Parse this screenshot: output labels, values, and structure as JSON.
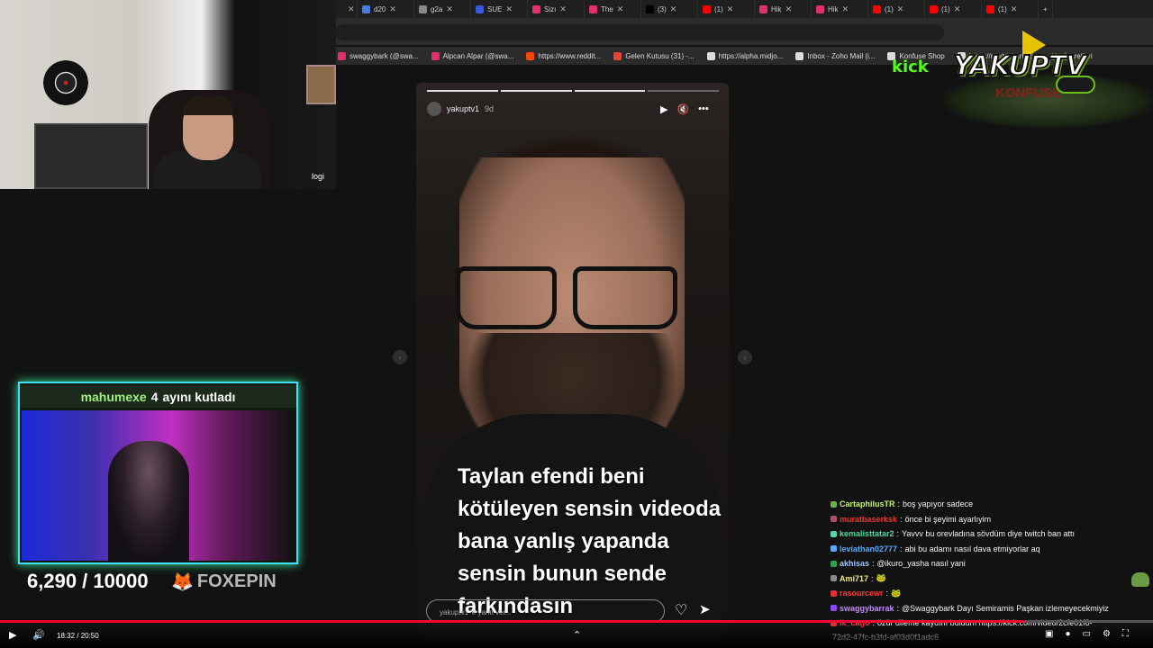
{
  "tabs": [
    {
      "label": "",
      "color": "#444444"
    },
    {
      "label": "d20",
      "color": "#4a7bd8"
    },
    {
      "label": "g2a",
      "color": "#888888"
    },
    {
      "label": "SUE",
      "color": "#3a5bd8"
    },
    {
      "label": "Sizı",
      "color": "#e1306c"
    },
    {
      "label": "The",
      "color": "#e1306c"
    },
    {
      "label": "(3) ",
      "color": "#000000"
    },
    {
      "label": "(1) ",
      "color": "#ff0000"
    },
    {
      "label": "Hik",
      "color": "#e1306c"
    },
    {
      "label": "Hik",
      "color": "#e1306c"
    },
    {
      "label": "(1) ",
      "color": "#ff0000"
    },
    {
      "label": "(1) ",
      "color": "#ff0000"
    },
    {
      "label": "(1) ",
      "color": "#ff0000"
    }
  ],
  "new_tab": "+",
  "bookmarks": [
    {
      "label": "swaggybark (@swa...",
      "color": "#e1306c"
    },
    {
      "label": "Alpcan Alpar (@swa...",
      "color": "#e1306c"
    },
    {
      "label": "https://www.reddit...",
      "color": "#ff4500"
    },
    {
      "label": "Gelen Kutusu (31) -...",
      "color": "#ea4335"
    },
    {
      "label": "https://alpha.midjo...",
      "color": "#dddddd"
    },
    {
      "label": "Inbox - Zoho Mail (i...",
      "color": "#dddddd"
    },
    {
      "label": "Konfuse Shop",
      "color": "#dddddd"
    },
    {
      "label": "https://next.inkarnati...",
      "color": "#dddddd"
    }
  ],
  "bookmarks_trailing": "Yer İşaretleri",
  "webcam": {
    "label": "logi"
  },
  "story": {
    "username": "yakuptv1",
    "age": "9d",
    "caption": "Taylan efendi beni kötüleyen sensin videoda bana yanlış yapanda sensin bunun sende farkındasın",
    "reply_placeholder": "yakuptv1 'e yanıt ver...",
    "icons": [
      "play-icon",
      "mute-icon",
      "more-icon"
    ],
    "progress_segments": 4,
    "progress_filled": 3
  },
  "logo": {
    "kick": "kick",
    "brand": "YAKUPTV",
    "bg_text": "KONFUSE"
  },
  "alert": {
    "name": "mahumexe",
    "months": "4",
    "suffix": "ayını kutladı"
  },
  "goal": {
    "text": "6,290 / 10000",
    "sponsor": "FOXEPIN"
  },
  "chat": [
    {
      "user": "CartaphilusTR",
      "color": "#c7f36a",
      "text": "boş yapıyor sadece",
      "badge": "#6ab04c"
    },
    {
      "user": "muratbaserksk",
      "color": "#e53935",
      "text": "önce bi şeyimi ayarlıyim",
      "badge": "#a56"
    },
    {
      "user": "kemalisttatar2",
      "color": "#53d6a0",
      "text": "Yavvv bu orevladına sövdüm diye twitch ban attı",
      "badge": "#53d6a0"
    },
    {
      "user": "leviathan02777",
      "color": "#5aa9ff",
      "text": "abi bu adamı nasıl dava etmiyorlar aq",
      "badge": "#5aa9ff"
    },
    {
      "user": "akhisas",
      "color": "#a0c4ff",
      "text": "@ikuro_yasha nasıl yani",
      "badge": "#2aa34a"
    },
    {
      "user": "Ami717",
      "color": "#f5e97a",
      "text": "🐸",
      "badge": "#888"
    },
    {
      "user": "rasourcewr",
      "color": "#ff3a3a",
      "text": "🐸",
      "badge": "#d33"
    },
    {
      "user": "swaggybarrak",
      "color": "#c38bff",
      "text": "@Swaggybark Dayı Semiramis Paşkan izlemeyecekmiyiz",
      "badge": "#9146ff"
    },
    {
      "user": "lk_cago",
      "color": "#ff3a3a",
      "text": "özür dileme kaydını buldum https://kick.com/video/2cfe01f8-",
      "badge": "#d33"
    }
  ],
  "chat_tail": "72d2-47fc-b3fd-af03d0f1adc6",
  "player": {
    "time": "18:32 / 20:50",
    "progress_fraction": 0.889
  }
}
